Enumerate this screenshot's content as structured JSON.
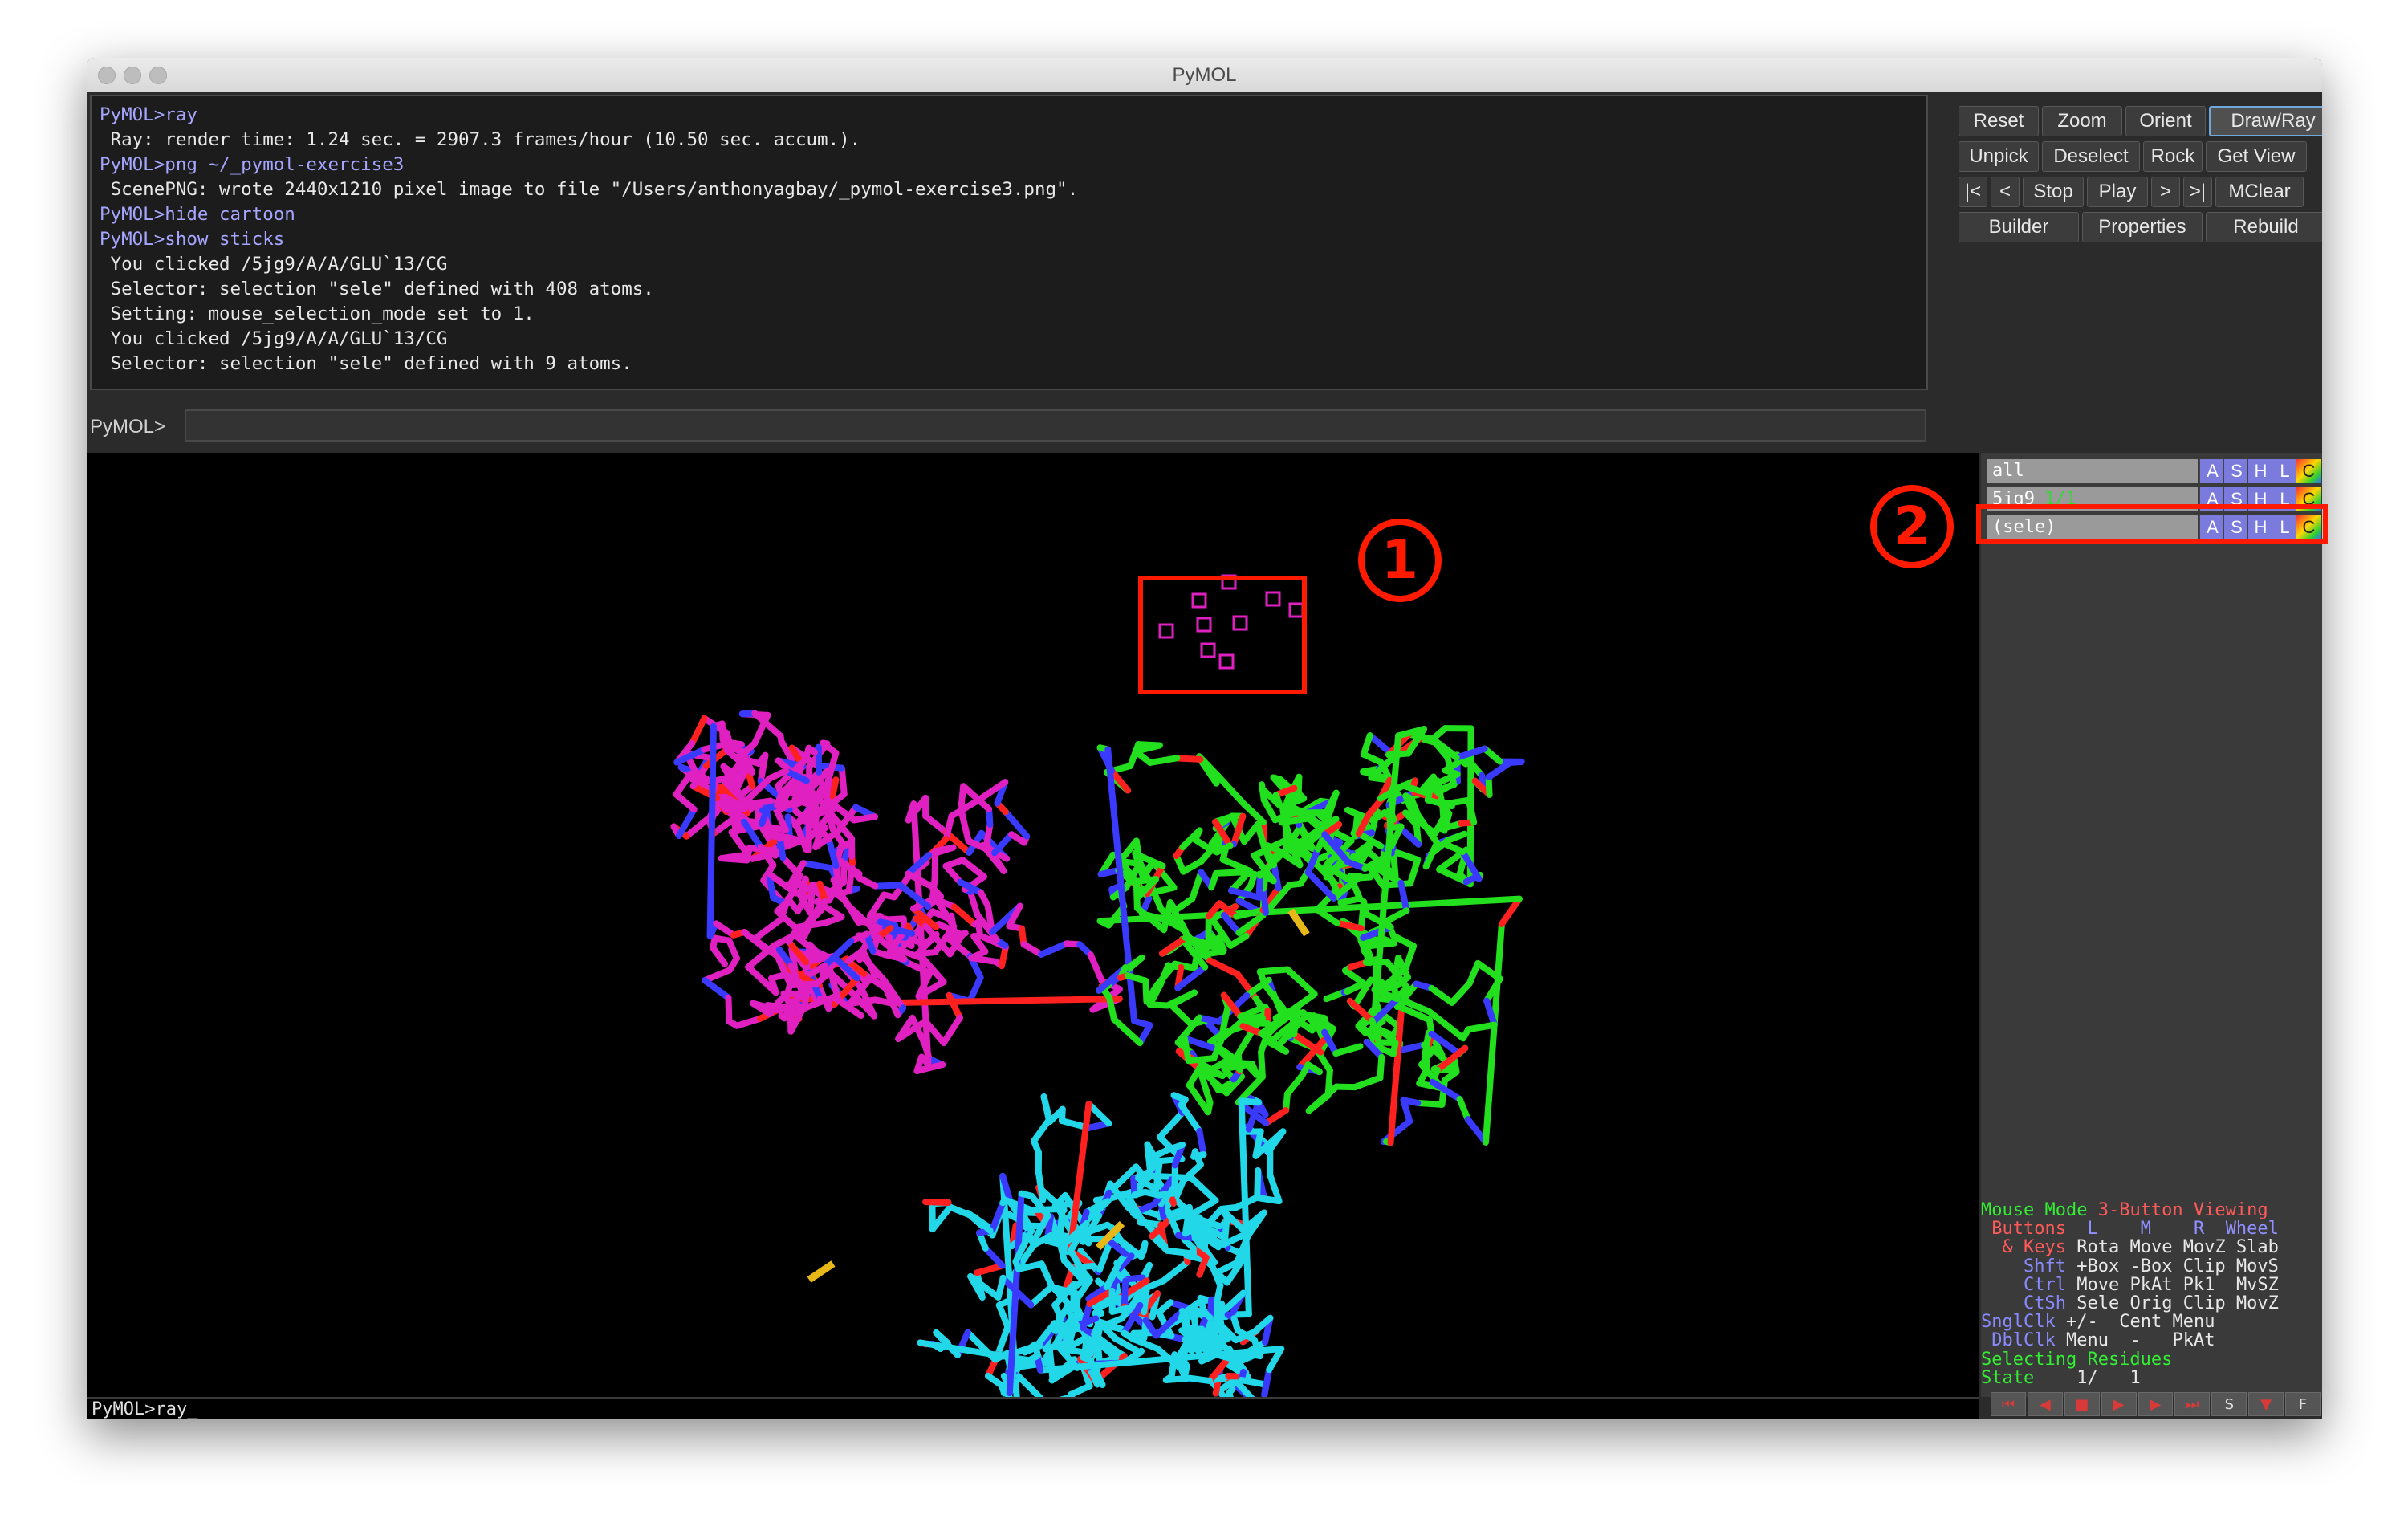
{
  "window": {
    "title": "PyMOL"
  },
  "console": {
    "lines": [
      {
        "text": "PyMOL>ray",
        "kind": "cmd"
      },
      {
        "text": " Ray: render time: 1.24 sec. = 2907.3 frames/hour (10.50 sec. accum.).",
        "kind": "out"
      },
      {
        "text": "PyMOL>png ~/_pymol-exercise3",
        "kind": "cmd"
      },
      {
        "text": " ScenePNG: wrote 2440x1210 pixel image to file \"/Users/anthonyagbay/_pymol-exercise3.png\".",
        "kind": "out"
      },
      {
        "text": "PyMOL>hide cartoon",
        "kind": "cmd"
      },
      {
        "text": "PyMOL>show sticks",
        "kind": "cmd"
      },
      {
        "text": " You clicked /5jg9/A/A/GLU`13/CG",
        "kind": "out"
      },
      {
        "text": " Selector: selection \"sele\" defined with 408 atoms.",
        "kind": "out"
      },
      {
        "text": " Setting: mouse_selection_mode set to 1.",
        "kind": "out"
      },
      {
        "text": " You clicked /5jg9/A/A/GLU`13/CG",
        "kind": "out"
      },
      {
        "text": " Selector: selection \"sele\" defined with 9 atoms.",
        "kind": "out"
      }
    ]
  },
  "command": {
    "label": "PyMOL>",
    "value": ""
  },
  "toolbar": {
    "row1": [
      "Reset",
      "Zoom",
      "Orient",
      "Draw/Ray"
    ],
    "row2": [
      "Unpick",
      "Deselect",
      "Rock",
      "Get View"
    ],
    "row3": [
      "|<",
      "<",
      "Stop",
      "Play",
      ">",
      ">|",
      "MClear"
    ],
    "row4": [
      "Builder",
      "Properties",
      "Rebuild"
    ]
  },
  "objects": [
    {
      "name": "all",
      "count": ""
    },
    {
      "name": "5jg9",
      "count": "1/1"
    },
    {
      "name": "(sele)",
      "count": ""
    }
  ],
  "object_buttons": [
    "A",
    "S",
    "H",
    "L",
    "C"
  ],
  "mouse_info": {
    "mode_label": "Mouse Mode",
    "mode_value": "3-Button Viewing",
    "buttons_label": "Buttons",
    "btn_l": "L",
    "btn_m": "M",
    "btn_r": "R",
    "btn_wheel": "Wheel",
    "keys_label": "& Keys",
    "none_row": [
      "Rota",
      "Move",
      "MovZ",
      "Slab"
    ],
    "shft_label": "Shft",
    "shft_row": [
      "+Box",
      "-Box",
      "Clip",
      "MovS"
    ],
    "ctrl_label": "Ctrl",
    "ctrl_row": [
      "Move",
      "PkAt",
      "Pk1",
      "MvSZ"
    ],
    "ctsh_label": "CtSh",
    "ctsh_row": [
      "Sele",
      "Orig",
      "Clip",
      "MovZ"
    ],
    "snglclk_label": "SnglClk",
    "snglclk_row": [
      "+/-",
      "Cent",
      "Menu"
    ],
    "dblclk_label": "DblClk",
    "dblclk_row": [
      "Menu",
      "-",
      "PkAt"
    ],
    "selecting": "Selecting Residues",
    "state_label": "State",
    "state_value": "1/",
    "state_total": "1"
  },
  "viewer_status": "PyMOL>ray_",
  "annotations": {
    "one": "1",
    "two": "2"
  },
  "colors": {
    "chain_magenta": "#e020c0",
    "chain_green": "#22e01e",
    "chain_cyan": "#22d8e8",
    "nitrogen": "#3a3aff",
    "oxygen": "#ff2020",
    "sulfur": "#e8b818",
    "annotation_red": "#ff1a00"
  }
}
